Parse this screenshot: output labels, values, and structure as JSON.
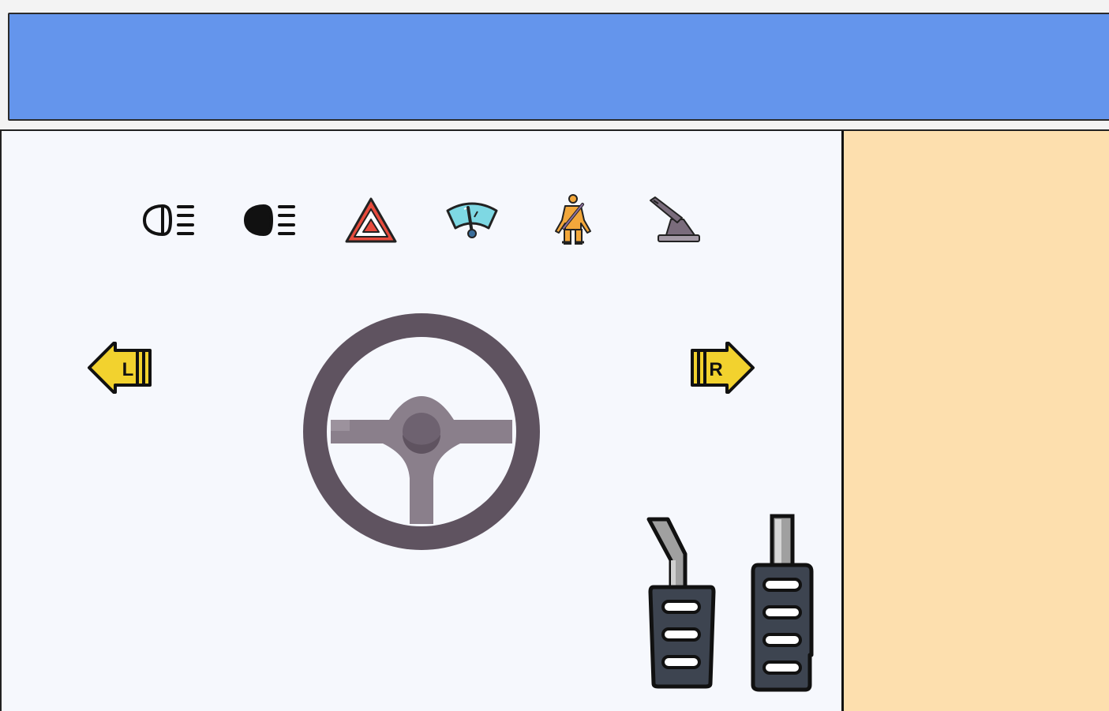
{
  "header": {
    "background_color": "#6495ec"
  },
  "side_panel": {
    "background_color": "#fddfae"
  },
  "controls": {
    "indicators": [
      {
        "name": "low-beam-icon"
      },
      {
        "name": "high-beam-icon"
      },
      {
        "name": "hazard-warning-icon"
      },
      {
        "name": "windshield-wiper-icon"
      },
      {
        "name": "seatbelt-icon"
      },
      {
        "name": "handbrake-icon"
      }
    ],
    "turn_left": {
      "icon": "turn-left-arrow-icon",
      "label": "L",
      "color": "#f2d22e"
    },
    "turn_right": {
      "icon": "turn-right-arrow-icon",
      "label": "R",
      "color": "#f2d22e"
    },
    "steering_wheel": {
      "icon": "steering-wheel-icon",
      "color": "#5f5360"
    },
    "pedals": [
      {
        "name": "brake-pedal-icon"
      },
      {
        "name": "accelerator-pedal-icon"
      }
    ]
  }
}
